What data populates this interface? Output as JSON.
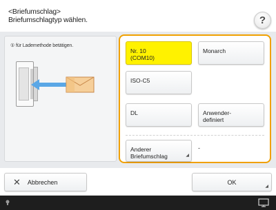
{
  "header": {
    "title_line1": "<Briefumschlag>",
    "title_line2": "Briefumschlagtyp wählen.",
    "help_label": "?"
  },
  "left_panel": {
    "instruction": "① für Lademethode betätigen."
  },
  "envelope_options": [
    {
      "label": "Nr. 10\n(COM10)",
      "selected": true
    },
    {
      "label": "Monarch",
      "selected": false
    },
    {
      "label": "ISO-C5",
      "selected": false
    },
    {
      "label": "DL",
      "selected": false
    },
    {
      "label": "Anwender-\ndefiniert",
      "selected": false
    },
    {
      "label": "Anderer\nBriefumschlag",
      "selected": false
    }
  ],
  "other_envelope_value": "-",
  "footer": {
    "cancel_label": "Abbrechen",
    "ok_label": "OK"
  },
  "colors": {
    "accent_border": "#f0a000",
    "selected_bg": "#fff200",
    "statusbar_bg": "#1e1e1e"
  },
  "icons": {
    "help": "question-mark-icon",
    "cancel": "close-icon",
    "arrow": "arrow-left-icon",
    "envelope": "envelope-icon",
    "status_left": "status-indicator-icon",
    "status_right": "monitor-icon"
  }
}
